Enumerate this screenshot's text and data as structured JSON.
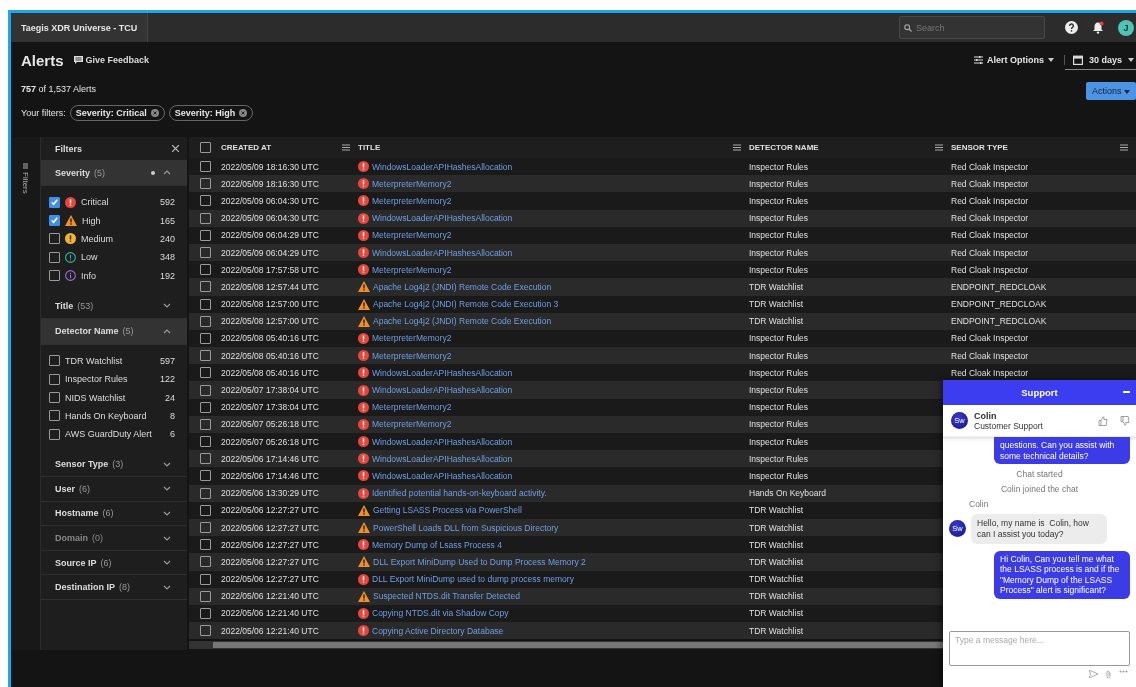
{
  "top_bar": {
    "tab": "Taegis XDR Universe - TCU",
    "search": {
      "placeholder": "Search"
    },
    "notifications": true,
    "avatar": "J"
  },
  "header": {
    "title": "Alerts",
    "feedback": "Give Feedback",
    "alert_options": "Alert Options",
    "date_range": "30 days",
    "actions": "Actions",
    "count": "**757** of 1,537 Alerts",
    "filters_label": "Your filters:",
    "filter_chips": [
      "Severity: Critical",
      "Severity: High"
    ]
  },
  "filters": {
    "tab": "Filters",
    "title": "Filters",
    "sections": [
      {
        "label": "Severity",
        "count": "(5)",
        "expanded": true,
        "active": true,
        "disabled": false,
        "options": [
          {
            "label": "Critical",
            "kind": "critical",
            "count": "592",
            "checked": true
          },
          {
            "label": "High",
            "kind": "high",
            "count": "165",
            "checked": true
          },
          {
            "label": "Medium",
            "kind": "medium",
            "count": "240",
            "checked": false
          },
          {
            "label": "Low",
            "kind": "low",
            "count": "348",
            "checked": false
          },
          {
            "label": "Info",
            "kind": "info",
            "count": "192",
            "checked": false
          }
        ]
      },
      {
        "label": "Title",
        "count": "(53)",
        "expanded": false,
        "active": false,
        "disabled": false
      },
      {
        "label": "Detector Name",
        "count": "(5)",
        "expanded": true,
        "active": false,
        "disabled": false,
        "options": [
          {
            "label": "TDR Watchlist",
            "count": "597",
            "checked": false
          },
          {
            "label": "Inspector Rules",
            "count": "122",
            "checked": false
          },
          {
            "label": "NIDS Watchlist",
            "count": "24",
            "checked": false
          },
          {
            "label": "Hands On Keyboard",
            "count": "8",
            "checked": false
          },
          {
            "label": "AWS GuardDuty Alert",
            "count": "6",
            "checked": false
          }
        ]
      },
      {
        "label": "Sensor Type",
        "count": "(3)",
        "expanded": false,
        "active": false,
        "disabled": false
      },
      {
        "label": "User",
        "count": "(6)",
        "expanded": false,
        "active": false,
        "disabled": false
      },
      {
        "label": "Hostname",
        "count": "(6)",
        "expanded": false,
        "active": false,
        "disabled": false
      },
      {
        "label": "Domain",
        "count": "(0)",
        "expanded": false,
        "active": false,
        "disabled": true
      },
      {
        "label": "Source IP",
        "count": "(6)",
        "expanded": false,
        "active": false,
        "disabled": false
      },
      {
        "label": "Destination IP",
        "count": "(8)",
        "expanded": false,
        "active": false,
        "disabled": false
      }
    ]
  },
  "table": {
    "all_selected": false,
    "columns": [
      "CREATED AT",
      "TITLE",
      "DETECTOR NAME",
      "SENSOR TYPE"
    ],
    "rows": [
      {
        "selected": false,
        "created_at": "2022/05/09 18:16:30 UTC",
        "kind": "critical",
        "title": "WindowsLoaderAPIHashesAllocation",
        "detector": "Inspector Rules",
        "sensor": "Red Cloak Inspector"
      },
      {
        "selected": false,
        "created_at": "2022/05/09 18:16:30 UTC",
        "kind": "critical",
        "title": "MeterpreterMemory2",
        "detector": "Inspector Rules",
        "sensor": "Red Cloak Inspector"
      },
      {
        "selected": false,
        "created_at": "2022/05/09 06:04:30 UTC",
        "kind": "critical",
        "title": "MeterpreterMemory2",
        "detector": "Inspector Rules",
        "sensor": "Red Cloak Inspector"
      },
      {
        "selected": false,
        "created_at": "2022/05/09 06:04:30 UTC",
        "kind": "critical",
        "title": "WindowsLoaderAPIHashesAllocation",
        "detector": "Inspector Rules",
        "sensor": "Red Cloak Inspector"
      },
      {
        "selected": false,
        "created_at": "2022/05/09 06:04:29 UTC",
        "kind": "critical",
        "title": "MeterpreterMemory2",
        "detector": "Inspector Rules",
        "sensor": "Red Cloak Inspector"
      },
      {
        "selected": false,
        "created_at": "2022/05/09 06:04:29 UTC",
        "kind": "critical",
        "title": "WindowsLoaderAPIHashesAllocation",
        "detector": "Inspector Rules",
        "sensor": "Red Cloak Inspector"
      },
      {
        "selected": false,
        "created_at": "2022/05/08 17:57:58 UTC",
        "kind": "critical",
        "title": "MeterpreterMemory2",
        "detector": "Inspector Rules",
        "sensor": "Red Cloak Inspector"
      },
      {
        "selected": false,
        "created_at": "2022/05/08 12:57:44 UTC",
        "kind": "high",
        "title": "Apache Log4j2 (JNDI) Remote Code Execution",
        "detector": "TDR Watchlist",
        "sensor": "ENDPOINT_REDCLOAK"
      },
      {
        "selected": false,
        "created_at": "2022/05/08 12:57:00 UTC",
        "kind": "high",
        "title": "Apache Log4j2 (JNDI) Remote Code Execution 3",
        "detector": "TDR Watchlist",
        "sensor": "ENDPOINT_REDCLOAK"
      },
      {
        "selected": false,
        "created_at": "2022/05/08 12:57:00 UTC",
        "kind": "high",
        "title": "Apache Log4j2 (JNDI) Remote Code Execution",
        "detector": "TDR Watchlist",
        "sensor": "ENDPOINT_REDCLOAK"
      },
      {
        "selected": false,
        "created_at": "2022/05/08 05:40:16 UTC",
        "kind": "critical",
        "title": "MeterpreterMemory2",
        "detector": "Inspector Rules",
        "sensor": "Red Cloak Inspector"
      },
      {
        "selected": false,
        "created_at": "2022/05/08 05:40:16 UTC",
        "kind": "critical",
        "title": "MeterpreterMemory2",
        "detector": "Inspector Rules",
        "sensor": "Red Cloak Inspector"
      },
      {
        "selected": false,
        "created_at": "2022/05/08 05:40:16 UTC",
        "kind": "critical",
        "title": "WindowsLoaderAPIHashesAllocation",
        "detector": "Inspector Rules",
        "sensor": "Red Cloak Inspector"
      },
      {
        "selected": false,
        "created_at": "2022/05/07 17:38:04 UTC",
        "kind": "critical",
        "title": "WindowsLoaderAPIHashesAllocation",
        "detector": "Inspector Rules"
      },
      {
        "selected": false,
        "created_at": "2022/05/07 17:38:04 UTC",
        "kind": "critical",
        "title": "MeterpreterMemory2",
        "detector": "Inspector Rules"
      },
      {
        "selected": false,
        "created_at": "2022/05/07 05:26:18 UTC",
        "kind": "critical",
        "title": "MeterpreterMemory2",
        "detector": "Inspector Rules"
      },
      {
        "selected": false,
        "created_at": "2022/05/07 05:26:18 UTC",
        "kind": "critical",
        "title": "WindowsLoaderAPIHashesAllocation",
        "detector": "Inspector Rules"
      },
      {
        "selected": false,
        "created_at": "2022/05/06 17:14:46 UTC",
        "kind": "critical",
        "title": "WindowsLoaderAPIHashesAllocation",
        "detector": "Inspector Rules"
      },
      {
        "selected": false,
        "created_at": "2022/05/06 17:14:46 UTC",
        "kind": "critical",
        "title": "WindowsLoaderAPIHashesAllocation",
        "detector": "Inspector Rules"
      },
      {
        "selected": false,
        "created_at": "2022/05/06 13:30:29 UTC",
        "kind": "critical",
        "title": "Identified potential hands-on-keyboard activity.",
        "detector": "Hands On Keyboard"
      },
      {
        "selected": false,
        "created_at": "2022/05/06 12:27:27 UTC",
        "kind": "high",
        "title": "Getting LSASS Process via PowerShell",
        "detector": "TDR Watchlist"
      },
      {
        "selected": false,
        "created_at": "2022/05/06 12:27:27 UTC",
        "kind": "high",
        "title": "PowerShell Loads DLL from Suspicious Directory",
        "detector": "TDR Watchlist"
      },
      {
        "selected": false,
        "created_at": "2022/05/06 12:27:27 UTC",
        "kind": "critical",
        "title": "Memory Dump of Lsass Process 4",
        "detector": "TDR Watchlist"
      },
      {
        "selected": false,
        "created_at": "2022/05/06 12:27:27 UTC",
        "kind": "high",
        "title": "DLL Export MiniDump Used to Dump Process Memory 2",
        "detector": "TDR Watchlist"
      },
      {
        "selected": false,
        "created_at": "2022/05/06 12:27:27 UTC",
        "kind": "critical",
        "title": "DLL Export MiniDump used to dump process memory",
        "detector": "TDR Watchlist"
      },
      {
        "selected": false,
        "created_at": "2022/05/06 12:21:40 UTC",
        "kind": "high",
        "title": "Suspected NTDS.dit Transfer Detected",
        "detector": "TDR Watchlist"
      },
      {
        "selected": false,
        "created_at": "2022/05/06 12:21:40 UTC",
        "kind": "critical",
        "title": "Copying NTDS.dit via Shadow Copy",
        "detector": "TDR Watchlist"
      },
      {
        "selected": false,
        "created_at": "2022/05/06 12:21:40 UTC",
        "kind": "critical",
        "title": "Copying Active Directory Database",
        "detector": "TDR Watchlist"
      }
    ]
  },
  "chat": {
    "title": "Support",
    "agent": {
      "avatar": "Sw",
      "name": "Colin",
      "role": "Customer Support"
    },
    "messages": [
      {
        "kind": "user",
        "text": "questions. Can you assist with some technical details?"
      },
      {
        "kind": "system",
        "text": "Chat started"
      },
      {
        "kind": "system",
        "text": "Colin joined the chat"
      },
      {
        "kind": "sender",
        "text": "Colin"
      },
      {
        "kind": "agent",
        "avatar": "Sw",
        "text": "Hello, my name is  Colin, how can I assist you today?"
      },
      {
        "kind": "user",
        "text": "Hi Colin, Can you tell me what the LSASS process is and if the \"Memory Dump of the LSASS Process\" alert is significant?"
      }
    ],
    "input": {
      "placeholder": "Type a message here..."
    }
  }
}
